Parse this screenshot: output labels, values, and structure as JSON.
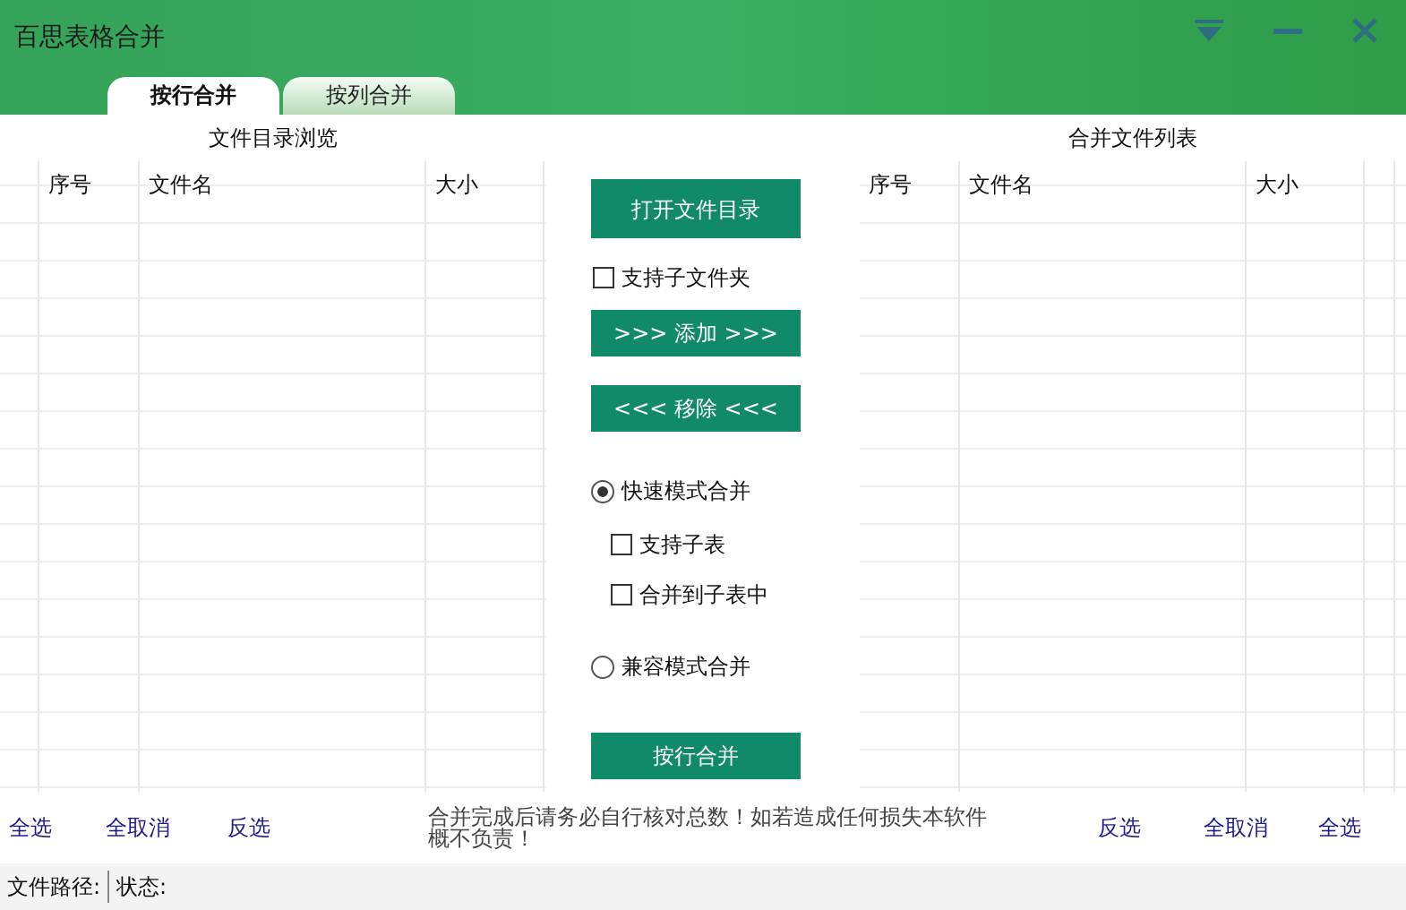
{
  "window": {
    "title": "百思表格合并"
  },
  "tabs": [
    {
      "label": "按行合并",
      "selected": true
    },
    {
      "label": "按列合并",
      "selected": false
    }
  ],
  "left_panel": {
    "title": "文件目录浏览",
    "columns": [
      "序号",
      "文件名",
      "大小"
    ],
    "links": [
      "全选",
      "全取消",
      "反选"
    ]
  },
  "middle": {
    "open_button": "打开文件目录",
    "include_subfolders": {
      "label": "支持子文件夹",
      "checked": false
    },
    "add_button": ">>> 添加 >>>",
    "remove_button": "<<< 移除 <<<",
    "modes": [
      {
        "label": "快速模式合并",
        "selected": true,
        "options": [
          {
            "label": "支持子表",
            "checked": false
          },
          {
            "label": "合并到子表中",
            "checked": false
          }
        ]
      },
      {
        "label": "兼容模式合并",
        "selected": false
      }
    ],
    "merge_button": "按行合并"
  },
  "notice": "合并完成后请务必自行核对总数！如若造成任何损失本软件概不负责！",
  "right_panel": {
    "title": "合并文件列表",
    "columns": [
      "序号",
      "文件名",
      "大小"
    ],
    "links": [
      "反选",
      "全取消",
      "全选"
    ]
  },
  "status_bar": {
    "path_label": "文件路径:",
    "status_label": "状态:"
  }
}
